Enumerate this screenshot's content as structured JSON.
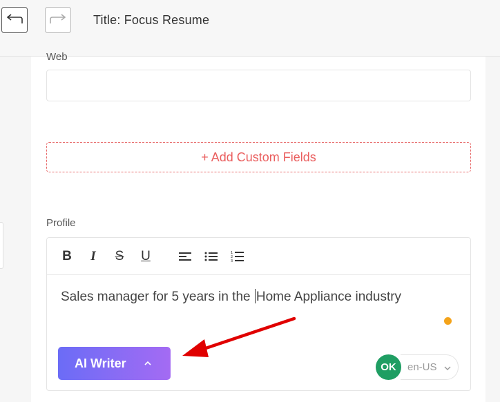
{
  "header": {
    "title": "Title: Focus Resume"
  },
  "form": {
    "web_label": "Web",
    "web_value": "",
    "add_custom_fields_label": "+ Add Custom Fields",
    "profile_label": "Profile"
  },
  "editor": {
    "text_before_caret": "Sales manager for 5 years in the ",
    "text_after_caret": "Home Appliance industry",
    "toolbar": {
      "bold_glyph": "B",
      "italic_glyph": "I",
      "strike_glyph": "S",
      "underline_glyph": "U"
    }
  },
  "ai_writer": {
    "label": "AI Writer"
  },
  "spellcheck": {
    "status": "OK",
    "language": "en-US"
  },
  "colors": {
    "accent_red": "#ea5f5f",
    "ai_gradient_start": "#6b6cf6",
    "ai_gradient_end": "#a46bf3",
    "ok_green": "#1f9e63",
    "indicator_orange": "#f4a31a",
    "annotation_arrow": "#e00000"
  }
}
